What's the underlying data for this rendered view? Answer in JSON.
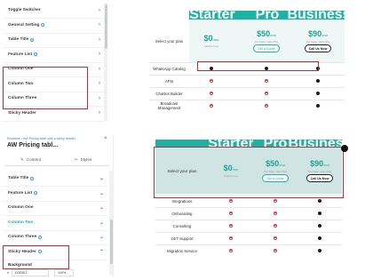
{
  "top_sidebar": {
    "items": [
      {
        "label": "Toggle Switcher"
      },
      {
        "label": "General Setting"
      },
      {
        "label": "Table Title"
      },
      {
        "label": "Feature List"
      },
      {
        "label": "Column One"
      },
      {
        "label": "Column Two"
      },
      {
        "label": "Column Three"
      },
      {
        "label": "Sticky Header"
      }
    ]
  },
  "top_table": {
    "headers": [
      "Starter",
      "Pro",
      "Business"
    ],
    "select_label": "Select your plan",
    "prices": [
      {
        "amount": "$0",
        "per": "/mo",
        "sub": "Lifetime Free",
        "button": ""
      },
      {
        "amount": "$50",
        "per": "/mo",
        "sub": "Per Seller, Gets 20%",
        "button": "Get a Quote"
      },
      {
        "amount": "$90",
        "per": "/mo",
        "sub": "Per Seller, Gets 20%",
        "button": "Call Us Now"
      }
    ],
    "features": [
      "WhatsApp Catalog",
      "APIs",
      "Chatbot Builder",
      "Broadcast Management"
    ],
    "marks": [
      [
        "black",
        "black",
        "black"
      ],
      [
        "red",
        "red",
        "black"
      ],
      [
        "red",
        "red",
        "black"
      ],
      [
        "red",
        "red",
        "black"
      ]
    ]
  },
  "bottom_sidebar": {
    "breadcrumb": "Elements › AW Pricing table with a sticky header",
    "title": "AW Pricing tabl...",
    "tab_content": "Content",
    "tab_styles": "Styles",
    "items": [
      {
        "label": "Table Title"
      },
      {
        "label": "Feature List"
      },
      {
        "label": "Column One"
      },
      {
        "label": "Column Two"
      },
      {
        "label": "Column Three"
      },
      {
        "label": "Sticky Header"
      }
    ],
    "background_label": "Background",
    "background_value": "D0E5E3",
    "opacity_value": "100%"
  },
  "bottom_table": {
    "headers": [
      "Starter",
      "Pro",
      "Business"
    ],
    "select_label": "Select your plan",
    "prices": [
      {
        "amount": "$0",
        "per": "/mo",
        "sub": "Lifetime Free",
        "button": ""
      },
      {
        "amount": "$50",
        "per": "/mo",
        "sub": "Per Seller, Gets 20%",
        "button": "Get a Quote"
      },
      {
        "amount": "$90",
        "per": "/mo",
        "sub": "Per Seller, Gets 20%",
        "button": "Call Us Now"
      }
    ],
    "features": [
      "Integrations",
      "Onboarding",
      "Consulting",
      "24/7 Support",
      "Migration Service"
    ],
    "marks": [
      [
        "red",
        "red",
        "black"
      ],
      [
        "red",
        "red",
        "black"
      ],
      [
        "red",
        "red",
        "black"
      ],
      [
        "red",
        "red",
        "black"
      ],
      [
        "red",
        "red",
        "black"
      ]
    ]
  },
  "colors": {
    "teal": "#1ab3a4",
    "red_outline": "#b5303c",
    "mark_red": "#e0333d"
  }
}
